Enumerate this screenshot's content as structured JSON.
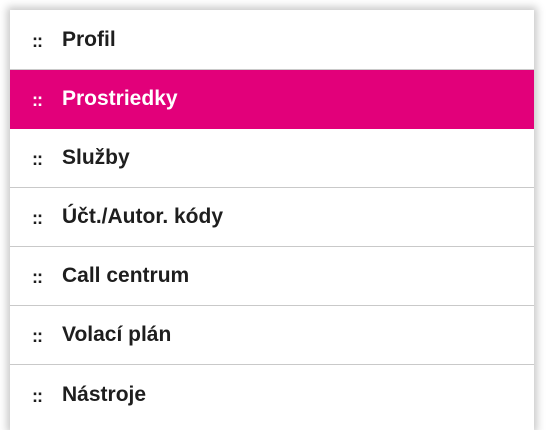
{
  "menu": {
    "bullet": "::",
    "active_color": "#e2007a",
    "items": [
      {
        "label": "Profil",
        "active": false
      },
      {
        "label": "Prostriedky",
        "active": true
      },
      {
        "label": "Služby",
        "active": false
      },
      {
        "label": "Účt./Autor. kódy",
        "active": false
      },
      {
        "label": "Call centrum",
        "active": false
      },
      {
        "label": "Volací plán",
        "active": false
      },
      {
        "label": "Nástroje",
        "active": false
      }
    ]
  }
}
